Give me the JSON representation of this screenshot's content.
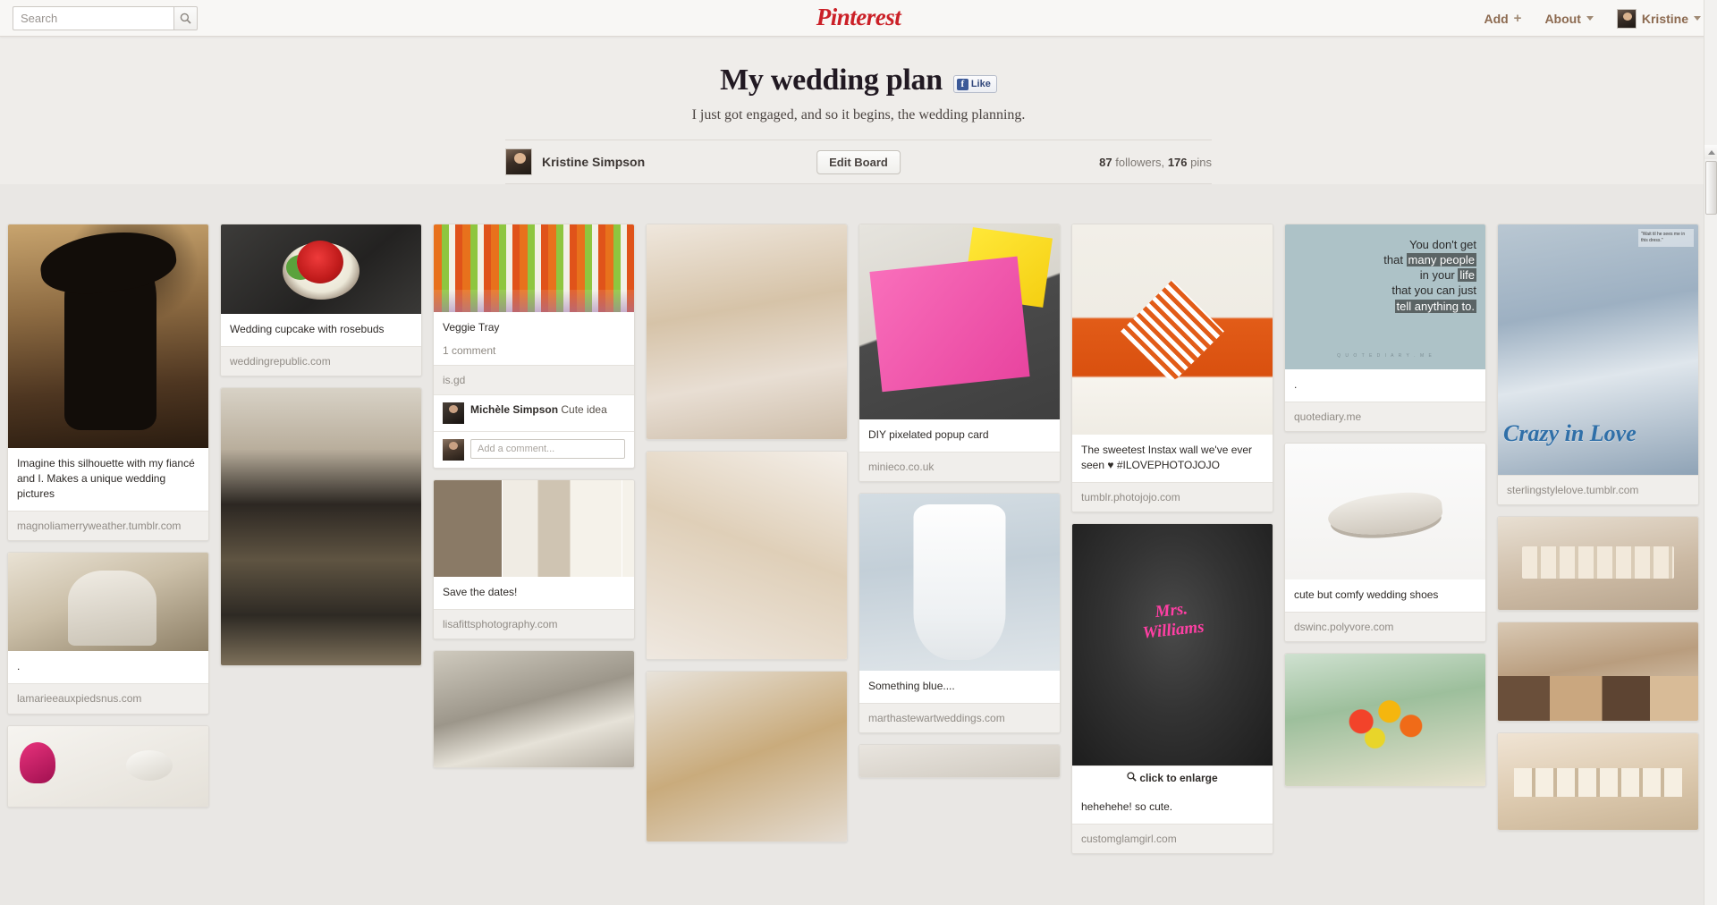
{
  "header": {
    "search_placeholder": "Search",
    "search_value": "",
    "search_icon": "search-icon",
    "logo": "Pinterest",
    "nav": {
      "add_label": "Add",
      "add_icon": "plus-icon",
      "about_label": "About",
      "about_icon": "chevron-down-icon",
      "user_label": "Kristine",
      "user_icon": "chevron-down-icon",
      "avatar": "user-avatar"
    }
  },
  "board": {
    "title": "My wedding plan",
    "like_label": "Like",
    "like_icon": "facebook-icon",
    "description": "I just got engaged, and so it begins, the wedding planning.",
    "owner_name": "Kristine  Simpson",
    "edit_label": "Edit Board",
    "followers_count": "87",
    "followers_label": "followers,",
    "pins_count": "176",
    "pins_label": "pins"
  },
  "columns": [
    {
      "pins": [
        {
          "image": "cowgirl-silhouette",
          "description": "Imagine this silhouette with my fiancé and I. Makes a unique wedding pictures",
          "source": "magnoliamerryweather.tumblr.com"
        },
        {
          "image": "elderly-couple",
          "description": ".",
          "source": "lamarieeauxpiedsnus.com"
        },
        {
          "image": "name-tag-charm",
          "description": "",
          "source": ""
        }
      ]
    },
    {
      "pins": [
        {
          "image": "rose-cupcake",
          "description": "Wedding cupcake with rosebuds",
          "source": "weddingrepublic.com"
        },
        {
          "image": "terrarium-centerpieces",
          "description": "",
          "source": ""
        }
      ]
    },
    {
      "pins": [
        {
          "image": "veggie-tray-cups",
          "description": "Veggie Tray",
          "comment_count": "1 comment",
          "source": "is.gd",
          "comment_author": "Michèle Simpson",
          "comment_text": "Cute idea",
          "add_comment_placeholder": "Add a comment...",
          "add_comment_value": ""
        },
        {
          "image": "save-the-date-photos",
          "description": "Save the dates!",
          "source": "lisafittsphotography.com"
        },
        {
          "image": "ring-display",
          "description": "",
          "source": ""
        }
      ]
    },
    {
      "pins": [
        {
          "image": "updo-hair-flower",
          "description": "",
          "source": ""
        },
        {
          "image": "updo-hair-bow",
          "description": "",
          "source": ""
        },
        {
          "image": "updo-hair-curls",
          "description": "",
          "source": ""
        }
      ]
    },
    {
      "pins": [
        {
          "image": "pixelated-popup-card",
          "description": "DIY pixelated popup card",
          "source": "minieco.co.uk"
        },
        {
          "image": "wedding-dress-blue-ribbon",
          "description": "Something blue....",
          "source": "marthastewartweddings.com"
        },
        {
          "image": "wood-sign",
          "description": "",
          "source": ""
        }
      ]
    },
    {
      "pins": [
        {
          "image": "instax-photo-heart-wall",
          "description": "The sweetest Instax wall we've ever seen ♥ #ILOVEPHOTOJOJO",
          "source": "tumblr.photojojo.com"
        },
        {
          "image": "mrs-williams-sweatshirt",
          "enlarge_label": "click to enlarge",
          "enlarge_icon": "magnifier-icon",
          "description": "hehehehe! so cute.",
          "source": "customglamgirl.com"
        }
      ]
    },
    {
      "pins": [
        {
          "image": "quote-card",
          "quote_lines": [
            {
              "plain": "You don't get",
              "highlight": ""
            },
            {
              "plain": "that ",
              "highlight": "many people"
            },
            {
              "plain": "in your ",
              "highlight": "life"
            },
            {
              "plain": "that you can just",
              "highlight": ""
            },
            {
              "plain": "",
              "highlight": "tell anything to."
            }
          ],
          "quote_source": "Q U O T E D I A R Y . M E",
          "description": ".",
          "source": "quotediary.me"
        },
        {
          "image": "white-sandals",
          "description": "cute but comfy wedding shoes",
          "source": "dswinc.polyvore.com"
        },
        {
          "image": "flower-bouquet",
          "description": "",
          "source": ""
        }
      ]
    },
    {
      "pins": [
        {
          "image": "crazy-in-love-magazine",
          "magazine_headline": "Crazy in Love",
          "magazine_note": "\"Wait til he sees me in this dress.\"",
          "description": "",
          "source": "sterlingstylelove.tumblr.com"
        },
        {
          "image": "date-blocks",
          "description": "",
          "source": ""
        },
        {
          "image": "wedding-party-photo",
          "description": "",
          "source": ""
        },
        {
          "image": "scrabble-tiles-name",
          "description": "",
          "source": ""
        }
      ]
    }
  ]
}
